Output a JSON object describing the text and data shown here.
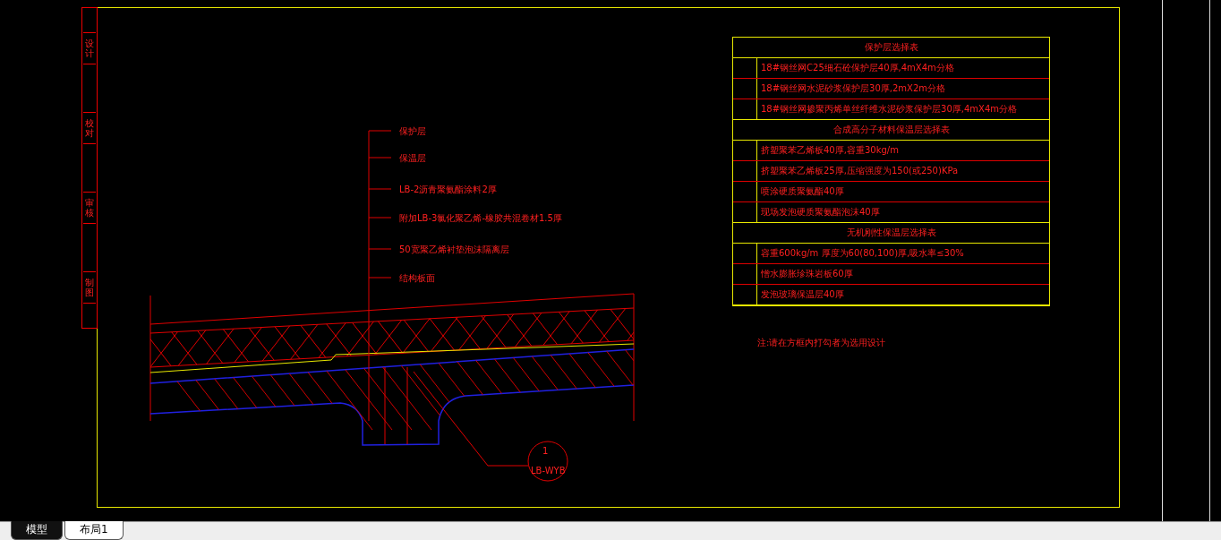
{
  "title_block": {
    "cells": [
      {
        "text": "设计"
      },
      {
        "text": "校对"
      },
      {
        "text": "审核"
      },
      {
        "text": "制图"
      }
    ]
  },
  "callouts": [
    {
      "text": "保护层"
    },
    {
      "text": "保温层"
    },
    {
      "text": "LB-2沥青聚氨酯涂料2厚"
    },
    {
      "text": "附加LB-3氯化聚乙烯-橡胶共混卷材1.5厚"
    },
    {
      "text": "50宽聚乙烯衬垫泡沫隔离层"
    },
    {
      "text": "结构板面"
    }
  ],
  "detail_marker": {
    "number": "1",
    "sheet": "LB-WYB"
  },
  "selection_table": {
    "sections": [
      {
        "title": "保护层选择表",
        "rows": [
          {
            "text": "18#钢丝网C25细石砼保护层40厚,4mX4m分格"
          },
          {
            "text": "18#钢丝网水泥砂浆保护层30厚,2mX2m分格"
          },
          {
            "text": "18#钢丝网掺聚丙烯单丝纤维水泥砂浆保护层30厚,4mX4m分格"
          }
        ]
      },
      {
        "title": "合成高分子材料保温层选择表",
        "rows": [
          {
            "text": "挤塑聚苯乙烯板40厚,容重30kg/m"
          },
          {
            "text": "挤塑聚苯乙烯板25厚,压缩强度为150(或250)KPa"
          },
          {
            "text": "喷涂硬质聚氨酯40厚"
          },
          {
            "text": "现场发泡硬质聚氨酯泡沫40厚"
          }
        ]
      },
      {
        "title": "无机刚性保温层选择表",
        "rows": [
          {
            "text": "容重600kg/m 厚度为60(80,100)厚,吸水率≤30%"
          },
          {
            "text": "憎水膨胀珍珠岩板60厚"
          },
          {
            "text": "发泡玻璃保温层40厚"
          }
        ]
      }
    ],
    "note": "注:请在方框内打勾者为选用设计"
  },
  "tabs": [
    {
      "label": "模型",
      "selected": true
    },
    {
      "label": "布局1",
      "selected": false
    }
  ]
}
